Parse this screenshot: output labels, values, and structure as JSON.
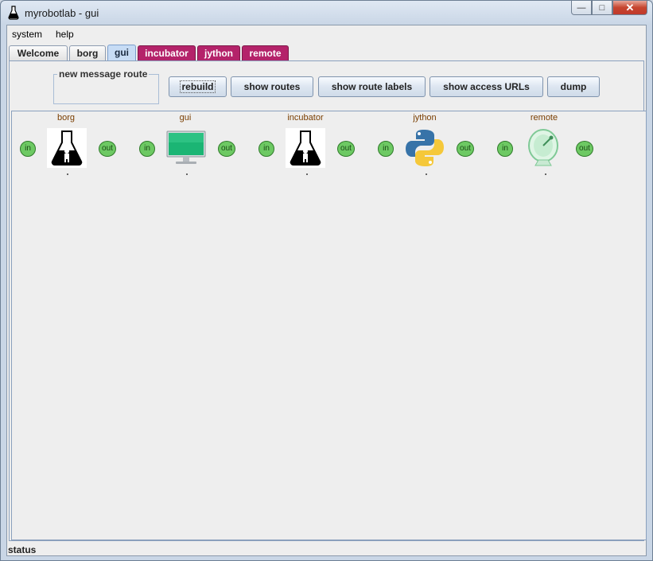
{
  "window": {
    "title": "myrobotlab - gui",
    "icon": "flask-icon",
    "controls": {
      "minimize": "minimize-icon",
      "maximize": "maximize-icon",
      "close": "close-icon"
    }
  },
  "menu": {
    "items": [
      "system",
      "help"
    ]
  },
  "tabs": [
    {
      "label": "Welcome",
      "state": "normal"
    },
    {
      "label": "borg",
      "state": "normal"
    },
    {
      "label": "gui",
      "state": "selected"
    },
    {
      "label": "incubator",
      "state": "highlight"
    },
    {
      "label": "jython",
      "state": "highlight"
    },
    {
      "label": "remote",
      "state": "highlight"
    }
  ],
  "toolbar": {
    "route_group_label": "new message route",
    "buttons": [
      "rebuild",
      "show routes",
      "show route labels",
      "show access URLs",
      "dump"
    ]
  },
  "services": [
    {
      "name": "borg",
      "icon": "flask-icon",
      "in": "in",
      "out": "out",
      "caption": "."
    },
    {
      "name": "gui",
      "icon": "monitor-icon",
      "in": "in",
      "out": "out",
      "caption": "."
    },
    {
      "name": "incubator",
      "icon": "flask-icon",
      "in": "in",
      "out": "out",
      "caption": "."
    },
    {
      "name": "jython",
      "icon": "python-logo-icon",
      "in": "in",
      "out": "out",
      "caption": "."
    },
    {
      "name": "remote",
      "icon": "satellite-dish-icon",
      "in": "in",
      "out": "out",
      "caption": "."
    }
  ],
  "status": "status",
  "colors": {
    "tab_highlight": "#b4236a",
    "tab_selected": "#c7dcf5",
    "port": "#6dc963",
    "service_label": "#7a3e00"
  }
}
